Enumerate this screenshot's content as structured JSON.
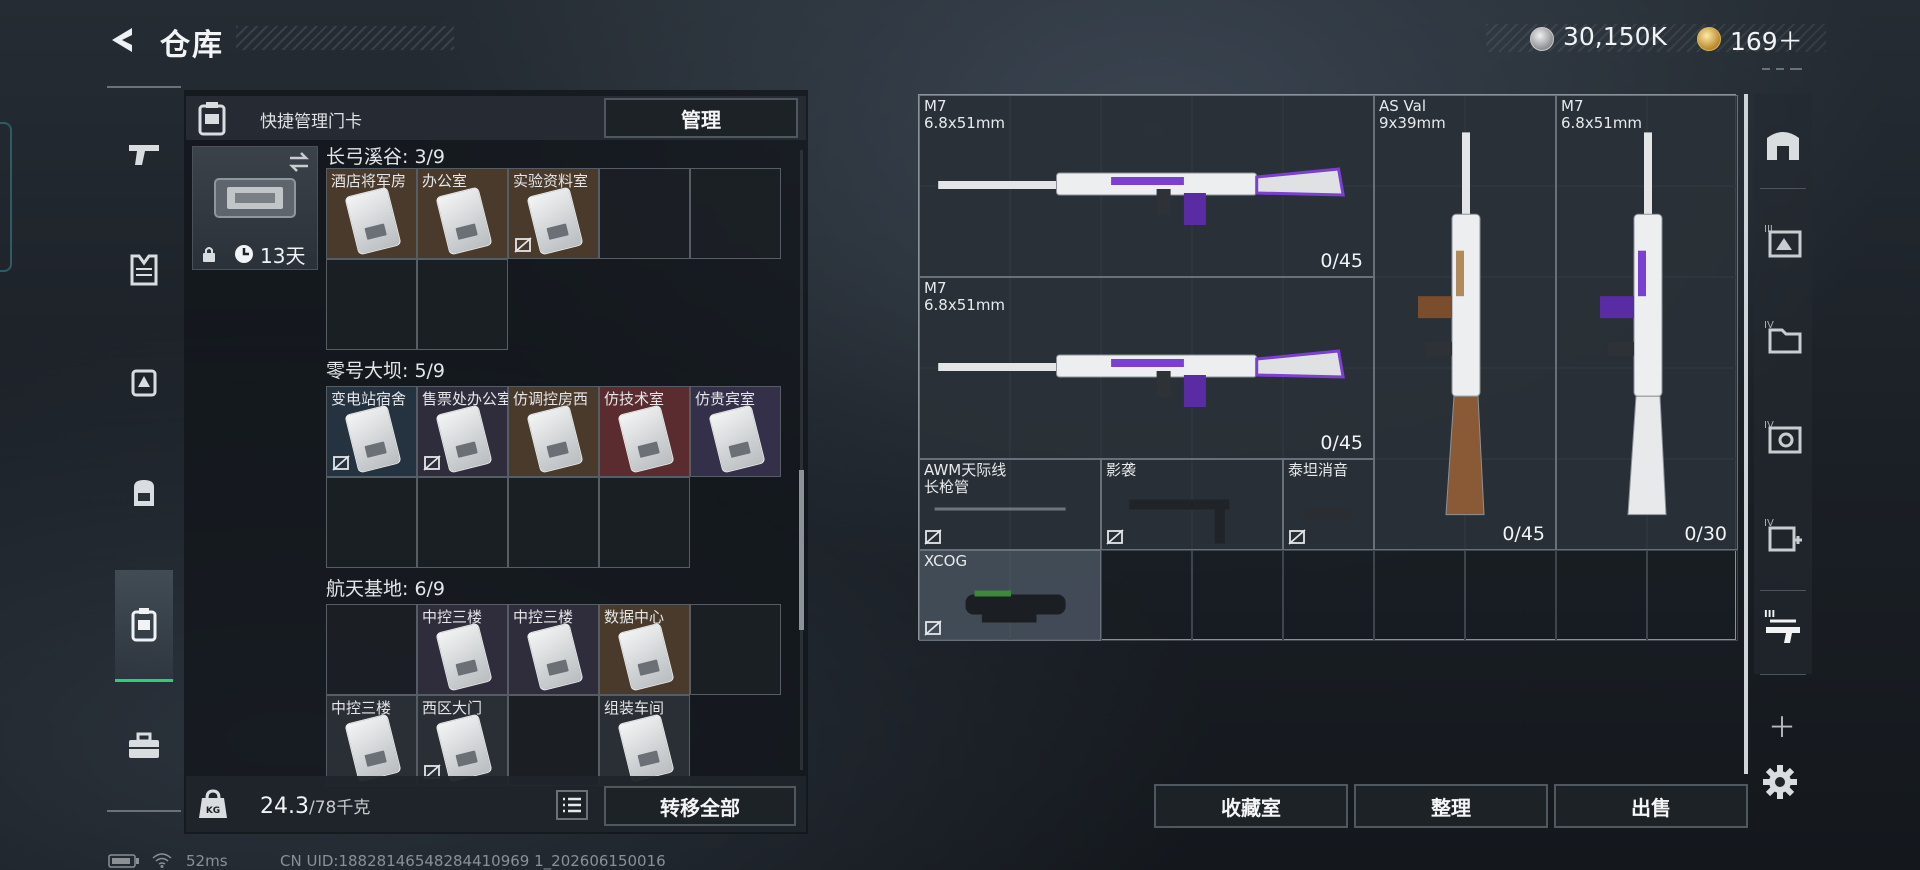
{
  "header": {
    "title": "仓库",
    "back_icon": "back-arrow-icon",
    "currency": [
      {
        "icon": "silver-coin-icon",
        "amount": "30,150K",
        "color": "#c8c8c8"
      },
      {
        "icon": "gold-coin-icon",
        "amount": "169＋",
        "color": "#d7b25c"
      }
    ]
  },
  "left_rail": {
    "items": [
      {
        "icon": "pistol-icon"
      },
      {
        "icon": "armor-vest-icon"
      },
      {
        "icon": "chest-rig-icon"
      },
      {
        "icon": "backpack-icon"
      },
      {
        "icon": "keycard-case-icon",
        "active": true
      },
      {
        "icon": "toolbox-icon"
      }
    ],
    "active_color": "#27d07a"
  },
  "left_panel": {
    "header_label": "快捷管理门卡",
    "manage_label": "管理",
    "keycard_days": "13天",
    "sections": [
      {
        "title": "长弓溪谷: 3/9",
        "cells": [
          {
            "label": "酒店将军房",
            "locked": false,
            "tint": "#4a3a2c"
          },
          {
            "label": "办公室",
            "locked": false,
            "tint": "#4a3a2c"
          },
          {
            "label": "实验资料室",
            "locked": true,
            "tint": "#4a3a2c"
          }
        ]
      },
      {
        "title": "零号大坝: 5/9",
        "cells": [
          {
            "label": "变电站宿舍",
            "locked": true,
            "tint": "#25323f"
          },
          {
            "label": "售票处办公室",
            "locked": true,
            "tint": "#2f2d3c"
          },
          {
            "label": "仿调控房西",
            "locked": false,
            "tint": "#4a3a2c"
          },
          {
            "label": "仿技术室",
            "locked": false,
            "tint": "#5a2b2f"
          },
          {
            "label": "仿贵宾室",
            "locked": false,
            "tint": "#34304a"
          }
        ]
      },
      {
        "title": "航天基地: 6/9",
        "cells": [
          {
            "label": "",
            "locked": false,
            "tint": ""
          },
          {
            "label": "中控三楼",
            "locked": false,
            "tint": "#2f2d3c"
          },
          {
            "label": "中控三楼",
            "locked": false,
            "tint": "#2f2d3c"
          },
          {
            "label": "数据中心",
            "locked": false,
            "tint": "#4a3a2c"
          },
          {
            "label": "",
            "locked": false,
            "tint": ""
          },
          {
            "label": "中控三楼",
            "locked": false,
            "tint": "#2a2e35"
          },
          {
            "label": "西区大门",
            "locked": true,
            "tint": "#2a2e35"
          },
          {
            "label": "",
            "locked": false,
            "tint": ""
          },
          {
            "label": "组装车间",
            "locked": false,
            "tint": "#2a2e35"
          }
        ]
      }
    ],
    "footer": {
      "weight": "24.3",
      "weight_capacity": "/78千克",
      "transfer_label": "转移全部"
    }
  },
  "storage": {
    "items": [
      {
        "name": "M7\n6.8x51mm",
        "ammo": "0/45",
        "icon": "rifle-icon",
        "locked": false
      },
      {
        "name": "M7\n6.8x51mm",
        "ammo": "0/45",
        "icon": "rifle-icon",
        "locked": false
      },
      {
        "name": "AS Val\n9x39mm",
        "ammo": "0/45",
        "icon": "rifle-vertical-icon",
        "locked": false
      },
      {
        "name": "M7\n6.8x51mm",
        "ammo": "0/30",
        "icon": "rifle-vertical-icon",
        "locked": false
      },
      {
        "name": "AWM天际线\n长枪管",
        "ammo": "",
        "icon": "barrel-icon",
        "locked": true
      },
      {
        "name": "影袭",
        "ammo": "",
        "icon": "stock-icon",
        "locked": true
      },
      {
        "name": "泰坦消音",
        "ammo": "",
        "icon": "suppressor-icon",
        "locked": true
      },
      {
        "name": "XCOG",
        "ammo": "",
        "icon": "scope-icon",
        "locked": true
      }
    ]
  },
  "bottom_buttons": {
    "collection": "收藏室",
    "sort": "整理",
    "sell": "出售"
  },
  "right_rail": {
    "items": [
      {
        "icon": "storage-room-icon"
      },
      {
        "icon": "tier3-container-icon"
      },
      {
        "icon": "tier4-container-icon"
      },
      {
        "icon": "tier4-safe-icon"
      },
      {
        "icon": "tier4-medkit-icon"
      },
      {
        "icon": "tier3-weapon-rack-icon"
      }
    ],
    "add": "＋",
    "settings_icon": "gear-icon"
  },
  "status": {
    "ping": "52ms",
    "uid": "CN UID:18828146548284410969 1_202606150016"
  }
}
